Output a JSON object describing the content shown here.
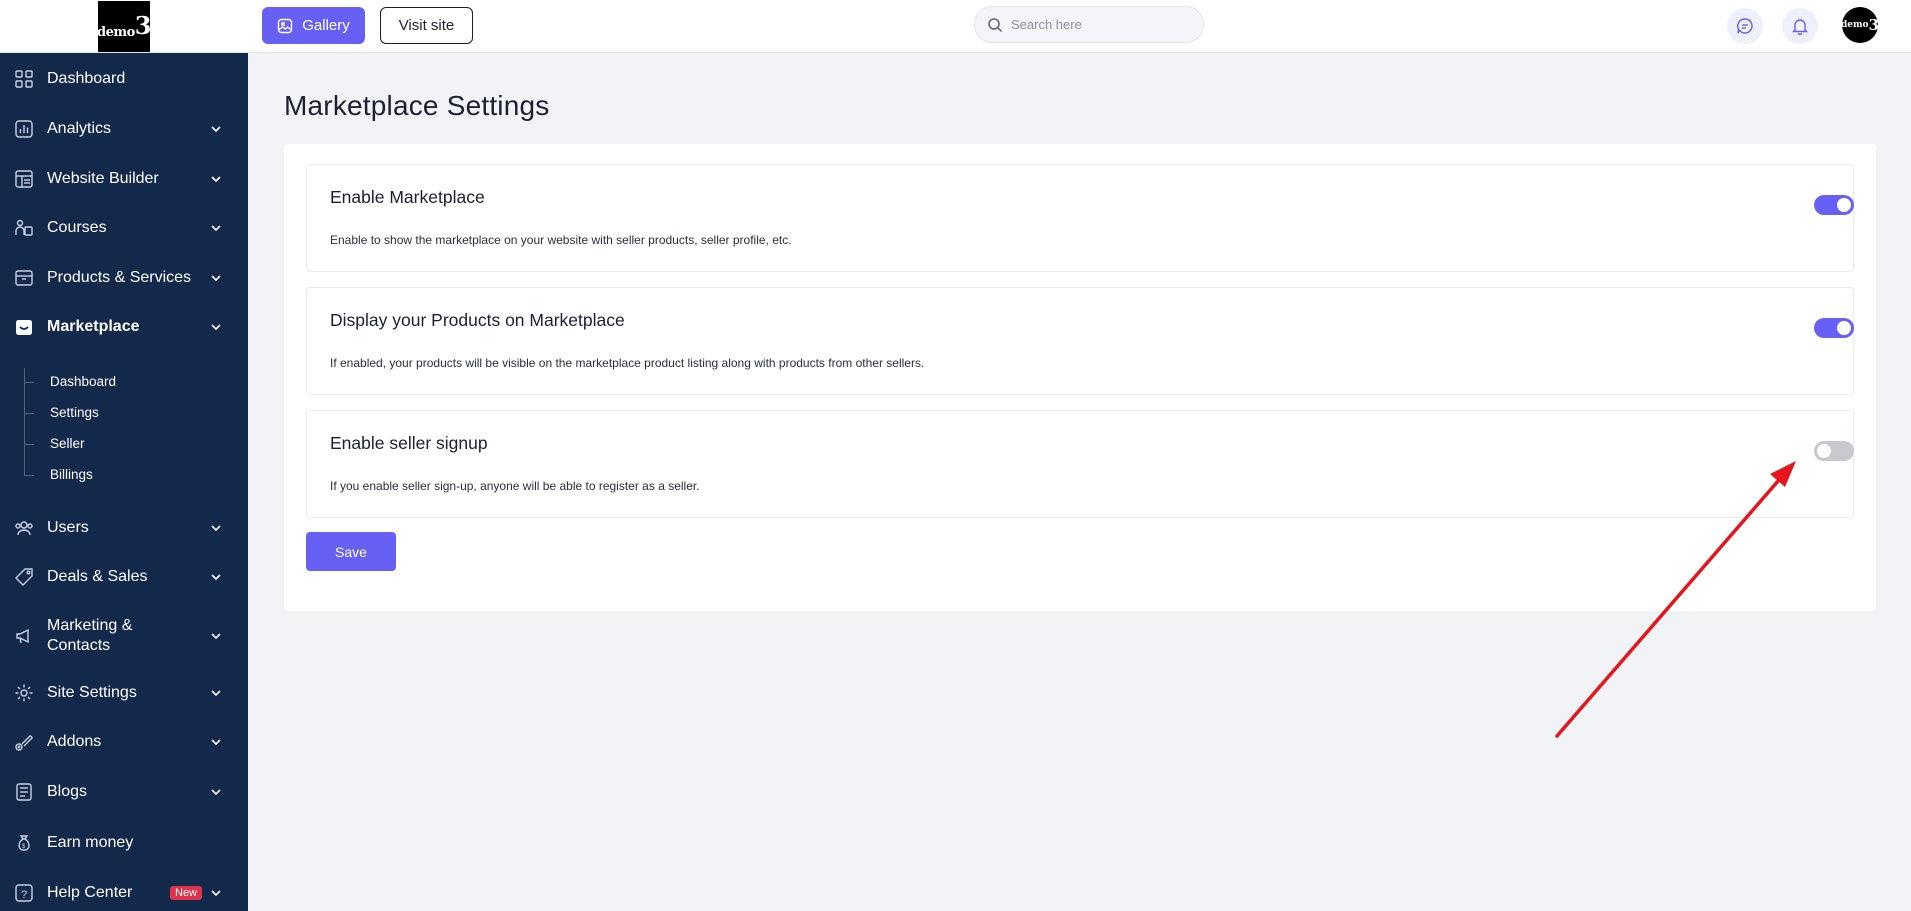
{
  "logo": {
    "text": "demo",
    "number": "3"
  },
  "topbar": {
    "gallery_label": "Gallery",
    "visit_site_label": "Visit site",
    "search_placeholder": "Search here",
    "avatar_text": "demo",
    "avatar_number": "3"
  },
  "sidebar": {
    "items": [
      {
        "label": "Dashboard",
        "icon": "grid-icon"
      },
      {
        "label": "Analytics",
        "icon": "chart-icon"
      },
      {
        "label": "Website Builder",
        "icon": "layout-icon"
      },
      {
        "label": "Courses",
        "icon": "courses-icon"
      },
      {
        "label": "Products & Services",
        "icon": "box-icon"
      },
      {
        "label": "Marketplace",
        "icon": "store-icon"
      },
      {
        "label": "Users",
        "icon": "users-icon"
      },
      {
        "label": "Deals & Sales",
        "icon": "tag-icon"
      },
      {
        "label": "Marketing &",
        "label2": "Contacts",
        "icon": "megaphone-icon"
      },
      {
        "label": "Site Settings",
        "icon": "gear-icon"
      },
      {
        "label": "Addons",
        "icon": "addons-icon"
      },
      {
        "label": "Blogs",
        "icon": "blog-icon"
      },
      {
        "label": "Earn money",
        "icon": "money-bag-icon"
      },
      {
        "label": "Help Center",
        "icon": "help-icon",
        "badge": "New"
      }
    ],
    "marketplace_sub": [
      "Dashboard",
      "Settings",
      "Seller",
      "Billings"
    ]
  },
  "main": {
    "title": "Marketplace Settings",
    "settings": [
      {
        "title": "Enable Marketplace",
        "description": "Enable to show the marketplace on your website with seller products, seller profile, etc.",
        "enabled": true
      },
      {
        "title": "Display your Products on Marketplace",
        "description": "If enabled, your products will be visible on the marketplace product listing along with products from other sellers.",
        "enabled": true
      },
      {
        "title": "Enable seller signup",
        "description": "If you enable seller sign-up, anyone will be able to register as a seller.",
        "enabled": false
      }
    ],
    "save_label": "Save"
  },
  "colors": {
    "accent": "#6760f5",
    "sidebar_bg": "#13294b",
    "annotation_arrow": "#e8141c"
  }
}
